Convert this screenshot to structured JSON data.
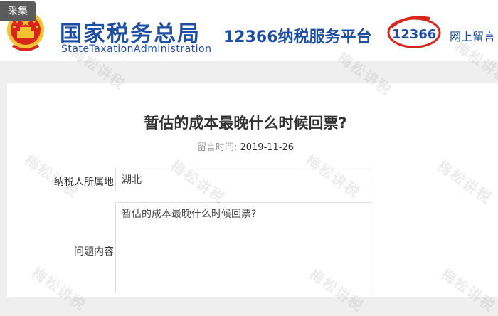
{
  "header": {
    "collect_tag": "采集",
    "brand_cn": "国家税务总局",
    "brand_en": "StateTaxationAdministration",
    "platform": "12366纳税服务平台",
    "logo_text": "12366",
    "message_link": "网上留言"
  },
  "question": {
    "title": "暂估的成本最晚什么时候回票?",
    "time_label": "留言时间:",
    "time_value": "2019-11-26",
    "region_label": "纳税人所属地",
    "region_value": "湖北",
    "content_label": "问题内容",
    "content_value": "暂估的成本最晚什么时候回票?"
  },
  "watermark": {
    "text": "梅松讲税"
  },
  "colors": {
    "brand_blue": "#1f4fa4",
    "emblem_red": "#d7261b",
    "emblem_gold": "#f2c230"
  }
}
